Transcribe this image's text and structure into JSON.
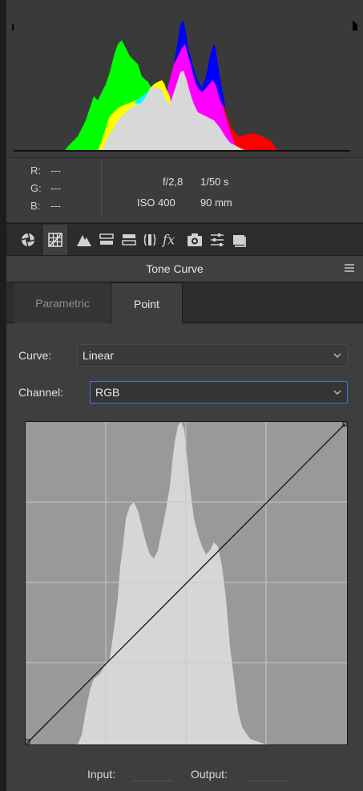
{
  "histogram": {
    "readout": {
      "labels": [
        "R:",
        "G:",
        "B:"
      ],
      "values": [
        "---",
        "---",
        "---"
      ]
    },
    "camera": {
      "aperture": "f/2,8",
      "shutter": "1/50 s",
      "iso": "ISO 400",
      "focal_length": "90 mm"
    }
  },
  "toolbar": {
    "tabs": [
      {
        "icon": "aperture-icon"
      },
      {
        "icon": "tone-curve-grid-icon"
      },
      {
        "icon": "detail-triangle-icon"
      },
      {
        "icon": "hsl-icon"
      },
      {
        "icon": "split-toning-icon"
      },
      {
        "icon": "lens-corrections-icon"
      },
      {
        "icon": "fx-icon"
      },
      {
        "icon": "camera-calibration-icon"
      },
      {
        "icon": "presets-sliders-icon"
      },
      {
        "icon": "snapshots-icon"
      }
    ]
  },
  "panel": {
    "title": "Tone Curve",
    "subtabs": [
      "Parametric",
      "Point"
    ],
    "active_subtab": "Point",
    "curve_label": "Curve:",
    "curve_value": "Linear",
    "channel_label": "Channel:",
    "channel_value": "RGB",
    "input_label": "Input:",
    "output_label": "Output:"
  },
  "colors": {
    "panel_bg": "#3e3e3e",
    "accent": "#3a7bd5",
    "red": "#ff0000",
    "green": "#00ff00",
    "blue": "#0000ff",
    "magenta": "#ff00ff",
    "yellow": "#ffff00",
    "cyan": "#00ffff",
    "gray": "#d8d8d8"
  }
}
